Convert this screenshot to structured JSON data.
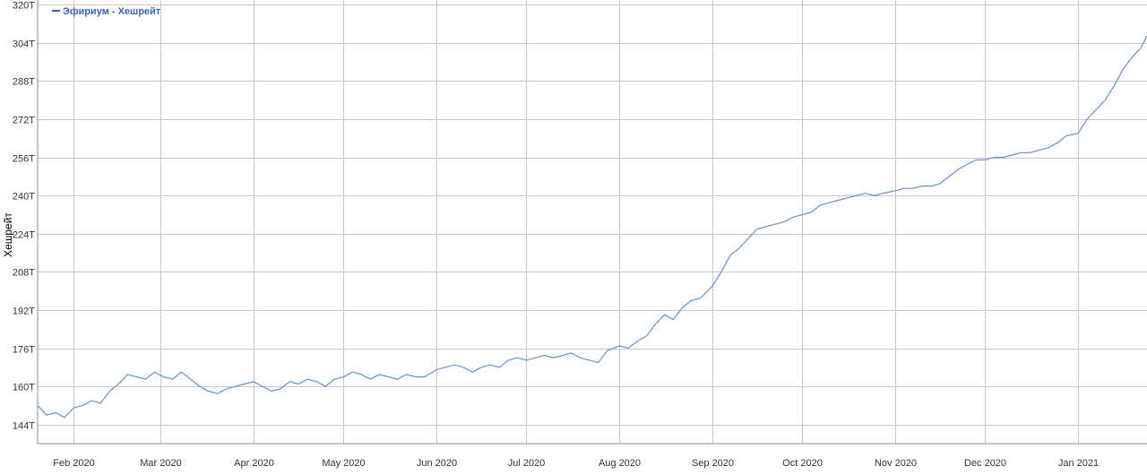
{
  "chart_data": {
    "type": "line",
    "title": "",
    "xlabel": "",
    "ylabel": "Хешрейт",
    "legend": {
      "position": "top-left",
      "entries": [
        "Эфириум - Хешрейт"
      ]
    },
    "grid": true,
    "colors": {
      "series": "#6c8fc7",
      "legend_text": "#3b64b8",
      "grid": "#c8c8c8",
      "axis": "#8a8a8a"
    },
    "xlim": [
      "2020-01-20",
      "2021-01-24"
    ],
    "ylim": [
      136,
      322
    ],
    "y_ticks": [
      144,
      160,
      176,
      192,
      208,
      224,
      240,
      256,
      272,
      288,
      304,
      320
    ],
    "y_tick_labels": [
      "144T",
      "160T",
      "176T",
      "192T",
      "208T",
      "224T",
      "240T",
      "256T",
      "272T",
      "288T",
      "304T",
      "320T"
    ],
    "x_ticks": [
      "2020-02-01",
      "2020-03-01",
      "2020-04-01",
      "2020-05-01",
      "2020-06-01",
      "2020-07-01",
      "2020-08-01",
      "2020-09-01",
      "2020-10-01",
      "2020-11-01",
      "2020-12-01",
      "2021-01-01"
    ],
    "x_tick_labels": [
      "Feb 2020",
      "Mar 2020",
      "Apr 2020",
      "May 2020",
      "Jun 2020",
      "Jul 2020",
      "Aug 2020",
      "Sep 2020",
      "Oct 2020",
      "Nov 2020",
      "Dec 2020",
      "Jan 2021"
    ],
    "series": [
      {
        "name": "Эфириум - Хешрейт",
        "x": [
          "2020-01-20",
          "2020-01-23",
          "2020-01-26",
          "2020-01-29",
          "2020-02-01",
          "2020-02-04",
          "2020-02-07",
          "2020-02-10",
          "2020-02-13",
          "2020-02-16",
          "2020-02-19",
          "2020-02-22",
          "2020-02-25",
          "2020-02-28",
          "2020-03-02",
          "2020-03-05",
          "2020-03-08",
          "2020-03-11",
          "2020-03-14",
          "2020-03-17",
          "2020-03-20",
          "2020-03-23",
          "2020-03-26",
          "2020-03-29",
          "2020-04-01",
          "2020-04-04",
          "2020-04-07",
          "2020-04-10",
          "2020-04-13",
          "2020-04-16",
          "2020-04-19",
          "2020-04-22",
          "2020-04-25",
          "2020-04-28",
          "2020-05-01",
          "2020-05-04",
          "2020-05-07",
          "2020-05-10",
          "2020-05-13",
          "2020-05-16",
          "2020-05-19",
          "2020-05-22",
          "2020-05-25",
          "2020-05-28",
          "2020-06-01",
          "2020-06-04",
          "2020-06-07",
          "2020-06-10",
          "2020-06-13",
          "2020-06-16",
          "2020-06-19",
          "2020-06-22",
          "2020-06-25",
          "2020-06-28",
          "2020-07-01",
          "2020-07-04",
          "2020-07-07",
          "2020-07-10",
          "2020-07-13",
          "2020-07-16",
          "2020-07-19",
          "2020-07-22",
          "2020-07-25",
          "2020-07-28",
          "2020-08-01",
          "2020-08-04",
          "2020-08-07",
          "2020-08-10",
          "2020-08-13",
          "2020-08-16",
          "2020-08-19",
          "2020-08-22",
          "2020-08-25",
          "2020-08-28",
          "2020-09-01",
          "2020-09-04",
          "2020-09-07",
          "2020-09-10",
          "2020-09-13",
          "2020-09-16",
          "2020-09-19",
          "2020-09-22",
          "2020-09-25",
          "2020-09-28",
          "2020-10-01",
          "2020-10-04",
          "2020-10-07",
          "2020-10-10",
          "2020-10-13",
          "2020-10-16",
          "2020-10-19",
          "2020-10-22",
          "2020-10-25",
          "2020-10-28",
          "2020-11-01",
          "2020-11-04",
          "2020-11-07",
          "2020-11-10",
          "2020-11-13",
          "2020-11-16",
          "2020-11-19",
          "2020-11-22",
          "2020-11-25",
          "2020-11-28",
          "2020-12-01",
          "2020-12-04",
          "2020-12-07",
          "2020-12-10",
          "2020-12-13",
          "2020-12-16",
          "2020-12-19",
          "2020-12-22",
          "2020-12-25",
          "2020-12-28",
          "2021-01-01",
          "2021-01-04",
          "2021-01-07",
          "2021-01-10",
          "2021-01-13",
          "2021-01-16",
          "2021-01-19",
          "2021-01-22",
          "2021-01-24"
        ],
        "values": [
          152,
          148,
          149,
          147,
          151,
          152,
          154,
          153,
          158,
          161,
          165,
          164,
          163,
          166,
          164,
          163,
          166,
          163,
          160,
          158,
          157,
          159,
          160,
          161,
          162,
          160,
          158,
          159,
          162,
          161,
          163,
          162,
          160,
          163,
          164,
          166,
          165,
          163,
          165,
          164,
          163,
          165,
          164,
          164,
          167,
          168,
          169,
          168,
          166,
          168,
          169,
          168,
          171,
          172,
          171,
          172,
          173,
          172,
          173,
          174,
          172,
          171,
          170,
          175,
          177,
          176,
          179,
          181,
          186,
          190,
          188,
          193,
          196,
          197,
          202,
          208,
          215,
          218,
          222,
          226,
          227,
          228,
          229,
          231,
          232,
          233,
          236,
          237,
          238,
          239,
          240,
          241,
          240,
          241,
          242,
          243,
          243,
          244,
          244,
          245,
          248,
          251,
          253,
          255,
          255,
          256,
          256,
          257,
          258,
          258,
          259,
          260,
          262,
          265,
          266,
          272,
          276,
          280,
          286,
          293,
          298,
          302,
          307
        ]
      }
    ]
  }
}
